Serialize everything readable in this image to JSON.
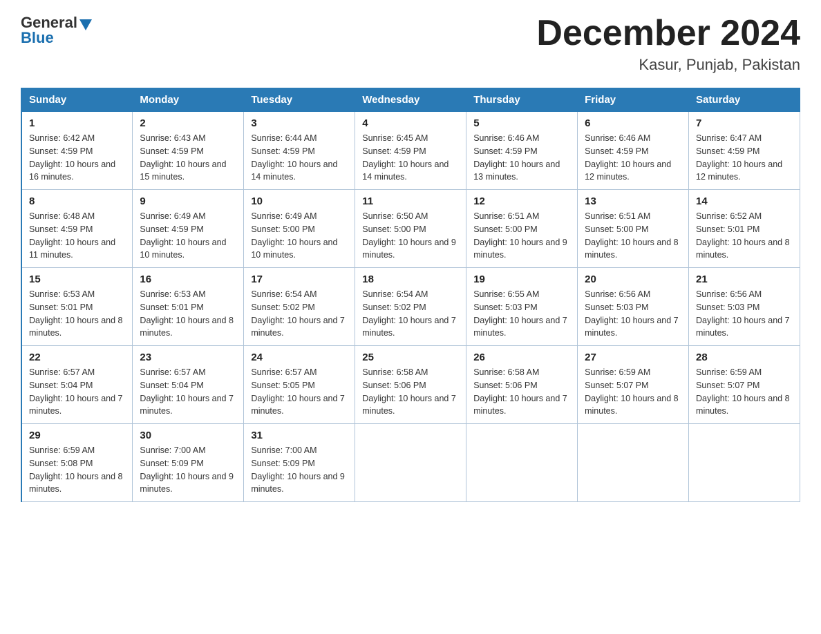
{
  "header": {
    "logo_general": "General",
    "logo_blue": "Blue",
    "title": "December 2024",
    "subtitle": "Kasur, Punjab, Pakistan"
  },
  "columns": [
    "Sunday",
    "Monday",
    "Tuesday",
    "Wednesday",
    "Thursday",
    "Friday",
    "Saturday"
  ],
  "weeks": [
    [
      {
        "day": "1",
        "sunrise": "Sunrise: 6:42 AM",
        "sunset": "Sunset: 4:59 PM",
        "daylight": "Daylight: 10 hours and 16 minutes."
      },
      {
        "day": "2",
        "sunrise": "Sunrise: 6:43 AM",
        "sunset": "Sunset: 4:59 PM",
        "daylight": "Daylight: 10 hours and 15 minutes."
      },
      {
        "day": "3",
        "sunrise": "Sunrise: 6:44 AM",
        "sunset": "Sunset: 4:59 PM",
        "daylight": "Daylight: 10 hours and 14 minutes."
      },
      {
        "day": "4",
        "sunrise": "Sunrise: 6:45 AM",
        "sunset": "Sunset: 4:59 PM",
        "daylight": "Daylight: 10 hours and 14 minutes."
      },
      {
        "day": "5",
        "sunrise": "Sunrise: 6:46 AM",
        "sunset": "Sunset: 4:59 PM",
        "daylight": "Daylight: 10 hours and 13 minutes."
      },
      {
        "day": "6",
        "sunrise": "Sunrise: 6:46 AM",
        "sunset": "Sunset: 4:59 PM",
        "daylight": "Daylight: 10 hours and 12 minutes."
      },
      {
        "day": "7",
        "sunrise": "Sunrise: 6:47 AM",
        "sunset": "Sunset: 4:59 PM",
        "daylight": "Daylight: 10 hours and 12 minutes."
      }
    ],
    [
      {
        "day": "8",
        "sunrise": "Sunrise: 6:48 AM",
        "sunset": "Sunset: 4:59 PM",
        "daylight": "Daylight: 10 hours and 11 minutes."
      },
      {
        "day": "9",
        "sunrise": "Sunrise: 6:49 AM",
        "sunset": "Sunset: 4:59 PM",
        "daylight": "Daylight: 10 hours and 10 minutes."
      },
      {
        "day": "10",
        "sunrise": "Sunrise: 6:49 AM",
        "sunset": "Sunset: 5:00 PM",
        "daylight": "Daylight: 10 hours and 10 minutes."
      },
      {
        "day": "11",
        "sunrise": "Sunrise: 6:50 AM",
        "sunset": "Sunset: 5:00 PM",
        "daylight": "Daylight: 10 hours and 9 minutes."
      },
      {
        "day": "12",
        "sunrise": "Sunrise: 6:51 AM",
        "sunset": "Sunset: 5:00 PM",
        "daylight": "Daylight: 10 hours and 9 minutes."
      },
      {
        "day": "13",
        "sunrise": "Sunrise: 6:51 AM",
        "sunset": "Sunset: 5:00 PM",
        "daylight": "Daylight: 10 hours and 8 minutes."
      },
      {
        "day": "14",
        "sunrise": "Sunrise: 6:52 AM",
        "sunset": "Sunset: 5:01 PM",
        "daylight": "Daylight: 10 hours and 8 minutes."
      }
    ],
    [
      {
        "day": "15",
        "sunrise": "Sunrise: 6:53 AM",
        "sunset": "Sunset: 5:01 PM",
        "daylight": "Daylight: 10 hours and 8 minutes."
      },
      {
        "day": "16",
        "sunrise": "Sunrise: 6:53 AM",
        "sunset": "Sunset: 5:01 PM",
        "daylight": "Daylight: 10 hours and 8 minutes."
      },
      {
        "day": "17",
        "sunrise": "Sunrise: 6:54 AM",
        "sunset": "Sunset: 5:02 PM",
        "daylight": "Daylight: 10 hours and 7 minutes."
      },
      {
        "day": "18",
        "sunrise": "Sunrise: 6:54 AM",
        "sunset": "Sunset: 5:02 PM",
        "daylight": "Daylight: 10 hours and 7 minutes."
      },
      {
        "day": "19",
        "sunrise": "Sunrise: 6:55 AM",
        "sunset": "Sunset: 5:03 PM",
        "daylight": "Daylight: 10 hours and 7 minutes."
      },
      {
        "day": "20",
        "sunrise": "Sunrise: 6:56 AM",
        "sunset": "Sunset: 5:03 PM",
        "daylight": "Daylight: 10 hours and 7 minutes."
      },
      {
        "day": "21",
        "sunrise": "Sunrise: 6:56 AM",
        "sunset": "Sunset: 5:03 PM",
        "daylight": "Daylight: 10 hours and 7 minutes."
      }
    ],
    [
      {
        "day": "22",
        "sunrise": "Sunrise: 6:57 AM",
        "sunset": "Sunset: 5:04 PM",
        "daylight": "Daylight: 10 hours and 7 minutes."
      },
      {
        "day": "23",
        "sunrise": "Sunrise: 6:57 AM",
        "sunset": "Sunset: 5:04 PM",
        "daylight": "Daylight: 10 hours and 7 minutes."
      },
      {
        "day": "24",
        "sunrise": "Sunrise: 6:57 AM",
        "sunset": "Sunset: 5:05 PM",
        "daylight": "Daylight: 10 hours and 7 minutes."
      },
      {
        "day": "25",
        "sunrise": "Sunrise: 6:58 AM",
        "sunset": "Sunset: 5:06 PM",
        "daylight": "Daylight: 10 hours and 7 minutes."
      },
      {
        "day": "26",
        "sunrise": "Sunrise: 6:58 AM",
        "sunset": "Sunset: 5:06 PM",
        "daylight": "Daylight: 10 hours and 7 minutes."
      },
      {
        "day": "27",
        "sunrise": "Sunrise: 6:59 AM",
        "sunset": "Sunset: 5:07 PM",
        "daylight": "Daylight: 10 hours and 8 minutes."
      },
      {
        "day": "28",
        "sunrise": "Sunrise: 6:59 AM",
        "sunset": "Sunset: 5:07 PM",
        "daylight": "Daylight: 10 hours and 8 minutes."
      }
    ],
    [
      {
        "day": "29",
        "sunrise": "Sunrise: 6:59 AM",
        "sunset": "Sunset: 5:08 PM",
        "daylight": "Daylight: 10 hours and 8 minutes."
      },
      {
        "day": "30",
        "sunrise": "Sunrise: 7:00 AM",
        "sunset": "Sunset: 5:09 PM",
        "daylight": "Daylight: 10 hours and 9 minutes."
      },
      {
        "day": "31",
        "sunrise": "Sunrise: 7:00 AM",
        "sunset": "Sunset: 5:09 PM",
        "daylight": "Daylight: 10 hours and 9 minutes."
      },
      null,
      null,
      null,
      null
    ]
  ]
}
